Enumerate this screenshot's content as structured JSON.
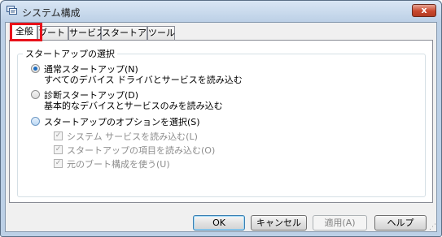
{
  "window": {
    "title": "システム構成",
    "title_icon": "system-config-icon",
    "close_label": "x"
  },
  "tabs": [
    {
      "label": "全般",
      "active": true
    },
    {
      "label": "ブート"
    },
    {
      "label": "サービス"
    },
    {
      "label": "スタートアップ"
    },
    {
      "label": "ツール"
    }
  ],
  "startup": {
    "group_label": "スタートアップの選択",
    "options": [
      {
        "label": "通常スタートアップ(N)",
        "description": "すべてのデバイス ドライバとサービスを読み込む",
        "checked": true
      },
      {
        "label": "診断スタートアップ(D)",
        "description": "基本的なデバイスとサービスのみを読み込む",
        "checked": false
      },
      {
        "label": "スタートアップのオプションを選択(S)",
        "checked": false
      }
    ],
    "sub_options": [
      {
        "label": "システム サービスを読み込む(L)",
        "checked": true
      },
      {
        "label": "スタートアップの項目を読み込む(O)",
        "checked": true
      },
      {
        "label": "元のブート構成を使う(U)",
        "checked": true
      }
    ]
  },
  "buttons": {
    "ok": "OK",
    "cancel": "キャンセル",
    "apply": "適用(A)",
    "help": "ヘルプ"
  },
  "colors": {
    "highlight": "#e8111a",
    "radio_dot": "#1d6ec2",
    "close_button": "#c9472d"
  }
}
